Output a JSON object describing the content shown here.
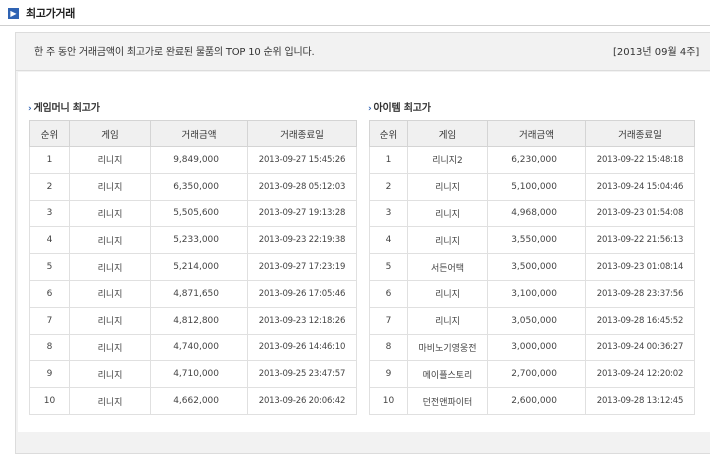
{
  "header": {
    "icon": "chevron-right-icon",
    "title": "최고가거래"
  },
  "notice": {
    "text": "한 주 동안 거래금액이 최고가로 완료된 물품의 TOP 10 순위 입니다.",
    "week": "[2013년 09월 4주]"
  },
  "columns": [
    "순위",
    "게임",
    "거래금액",
    "거래종료일"
  ],
  "game_money": {
    "title": "게임머니 최고가",
    "rows": [
      {
        "rank": "1",
        "game": "리니지",
        "price": "9,849,000",
        "date": "2013-09-27 15:45:26"
      },
      {
        "rank": "2",
        "game": "리니지",
        "price": "6,350,000",
        "date": "2013-09-28 05:12:03"
      },
      {
        "rank": "3",
        "game": "리니지",
        "price": "5,505,600",
        "date": "2013-09-27 19:13:28"
      },
      {
        "rank": "4",
        "game": "리니지",
        "price": "5,233,000",
        "date": "2013-09-23 22:19:38"
      },
      {
        "rank": "5",
        "game": "리니지",
        "price": "5,214,000",
        "date": "2013-09-27 17:23:19"
      },
      {
        "rank": "6",
        "game": "리니지",
        "price": "4,871,650",
        "date": "2013-09-26 17:05:46"
      },
      {
        "rank": "7",
        "game": "리니지",
        "price": "4,812,800",
        "date": "2013-09-23 12:18:26"
      },
      {
        "rank": "8",
        "game": "리니지",
        "price": "4,740,000",
        "date": "2013-09-26 14:46:10"
      },
      {
        "rank": "9",
        "game": "리니지",
        "price": "4,710,000",
        "date": "2013-09-25 23:47:57"
      },
      {
        "rank": "10",
        "game": "리니지",
        "price": "4,662,000",
        "date": "2013-09-26 20:06:42"
      }
    ]
  },
  "items": {
    "title": "아이템 최고가",
    "rows": [
      {
        "rank": "1",
        "game": "리니지2",
        "price": "6,230,000",
        "date": "2013-09-22 15:48:18"
      },
      {
        "rank": "2",
        "game": "리니지",
        "price": "5,100,000",
        "date": "2013-09-24 15:04:46"
      },
      {
        "rank": "3",
        "game": "리니지",
        "price": "4,968,000",
        "date": "2013-09-23 01:54:08"
      },
      {
        "rank": "4",
        "game": "리니지",
        "price": "3,550,000",
        "date": "2013-09-22 21:56:13"
      },
      {
        "rank": "5",
        "game": "서든어택",
        "price": "3,500,000",
        "date": "2013-09-23 01:08:14"
      },
      {
        "rank": "6",
        "game": "리니지",
        "price": "3,100,000",
        "date": "2013-09-28 23:37:56"
      },
      {
        "rank": "7",
        "game": "리니지",
        "price": "3,050,000",
        "date": "2013-09-28 16:45:52"
      },
      {
        "rank": "8",
        "game": "마비노기영웅전",
        "price": "3,000,000",
        "date": "2013-09-24 00:36:27"
      },
      {
        "rank": "9",
        "game": "메이플스토리",
        "price": "2,700,000",
        "date": "2013-09-24 12:20:02"
      },
      {
        "rank": "10",
        "game": "던전앤파이터",
        "price": "2,600,000",
        "date": "2013-09-28 13:12:45"
      }
    ]
  }
}
